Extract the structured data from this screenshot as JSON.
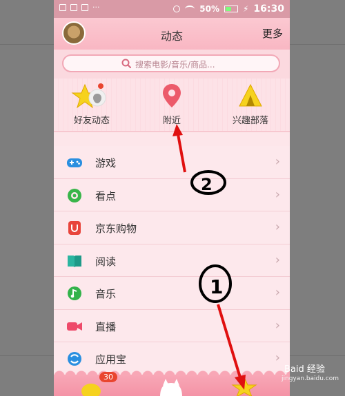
{
  "statusbar": {
    "dots": "···",
    "battery_percent": "50%",
    "charging_icon": "⚡",
    "time": "16:30"
  },
  "header": {
    "title": "动态",
    "more_label": "更多"
  },
  "search": {
    "placeholder": "搜索电影/音乐/商品..."
  },
  "quick_links": [
    {
      "label": "好友动态",
      "icon": "friends-feed-icon"
    },
    {
      "label": "附近",
      "icon": "location-pin-icon"
    },
    {
      "label": "兴趣部落",
      "icon": "tent-icon"
    }
  ],
  "list": [
    {
      "label": "游戏",
      "icon": "gamepad-icon",
      "color": "#2a8fe0"
    },
    {
      "label": "看点",
      "icon": "eye-icon",
      "color": "#39b54a"
    },
    {
      "label": "京东购物",
      "icon": "shopping-bag-icon",
      "color": "#e8453c"
    },
    {
      "label": "阅读",
      "icon": "book-icon",
      "color": "#2bb5a0"
    },
    {
      "label": "音乐",
      "icon": "music-icon",
      "color": "#32b24a"
    },
    {
      "label": "直播",
      "icon": "camera-icon",
      "color": "#ee4a6a"
    },
    {
      "label": "应用宝",
      "icon": "app-store-icon",
      "color": "#2a8fe0"
    }
  ],
  "arrow_glyph": "›",
  "bottom": {
    "badge_count": "30"
  },
  "annotations": {
    "mark_1": "1",
    "mark_2": "2"
  },
  "watermark": {
    "main": "Baid 经验",
    "sub": "jingyan.baidu.com"
  }
}
